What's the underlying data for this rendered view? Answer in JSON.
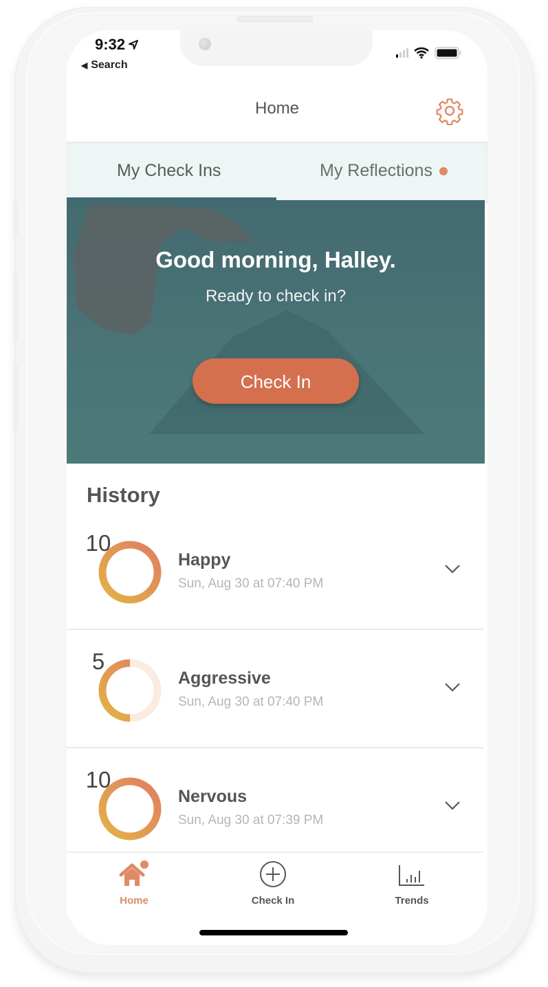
{
  "status_bar": {
    "time": "9:32",
    "back_label": "Search",
    "location_icon": "location-arrow-icon",
    "signal_icon": "cellular-signal-icon",
    "wifi_icon": "wifi-icon",
    "battery_icon": "battery-icon"
  },
  "header": {
    "title": "Home",
    "settings_icon": "gear-icon"
  },
  "tabs": [
    {
      "label": "My Check Ins",
      "active": true
    },
    {
      "label": "My Reflections",
      "active": false,
      "has_notification_dot": true
    }
  ],
  "hero": {
    "greeting": "Good morning, Halley.",
    "subtitle": "Ready to check in?",
    "button_label": "Check In"
  },
  "history": {
    "title": "History",
    "items": [
      {
        "emotion": "Happy",
        "score": "10",
        "score_value": 10,
        "score_max": 10,
        "timestamp": "Sun, Aug 30 at 07:40 PM"
      },
      {
        "emotion": "Aggressive",
        "score": "5",
        "score_value": 5,
        "score_max": 10,
        "timestamp": "Sun, Aug 30 at 07:40 PM"
      },
      {
        "emotion": "Nervous",
        "score": "10",
        "score_value": 10,
        "score_max": 10,
        "timestamp": "Sun, Aug 30 at 07:39 PM"
      }
    ]
  },
  "bottom_nav": [
    {
      "label": "Home",
      "icon": "home-icon",
      "active": true,
      "has_notification_dot": true
    },
    {
      "label": "Check In",
      "icon": "plus-circle-icon",
      "active": false
    },
    {
      "label": "Trends",
      "icon": "bar-chart-icon",
      "active": false
    }
  ],
  "colors": {
    "accent": "#d5704f",
    "accent_light": "#e08a66",
    "hero_bg": "#466f73",
    "tab_bg": "#eef5f5",
    "ring_start": "#e2b247",
    "ring_end": "#e07f62",
    "ring_track": "#fbebe3"
  }
}
